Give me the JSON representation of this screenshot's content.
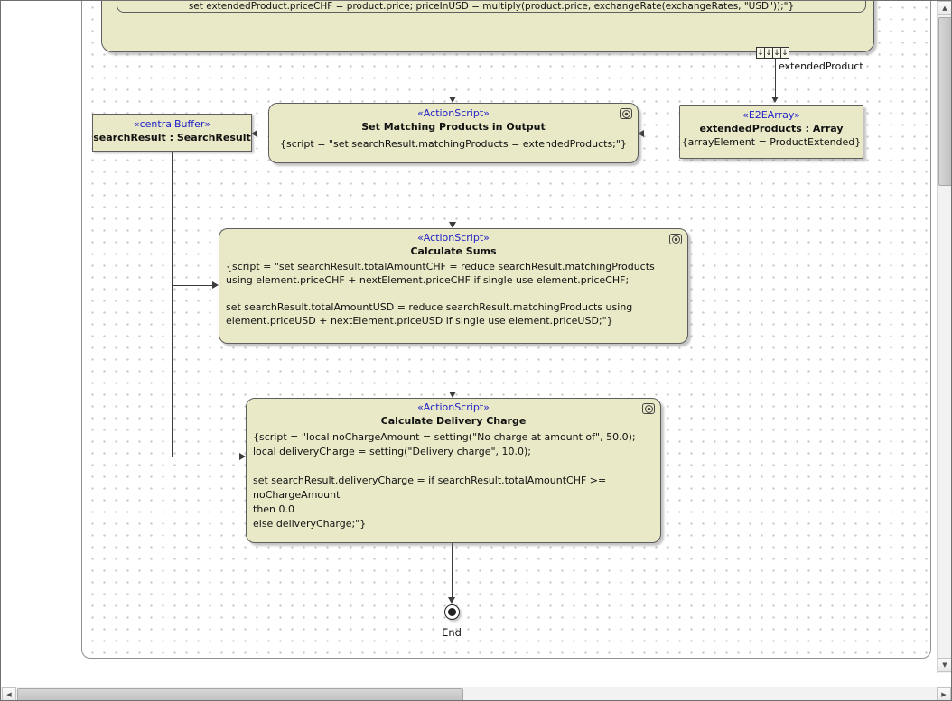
{
  "window": {
    "scrollbar_icons": {
      "up": "▲",
      "down": "▼",
      "left": "◀",
      "right": "▶"
    }
  },
  "diagram": {
    "colors": {
      "node_fill": "#e9e9c8",
      "node_border": "#5e5e5e",
      "stereotype_text": "#2121c8",
      "edge": "#3c3c3c",
      "grid_dot": "#c9c9c9"
    },
    "clipped_top_region": {
      "partial_script_text": "set extendedProduct.priceCHF = product.price; priceInUSD = multiply(product.price, exchangeRate(exchangeRates, \"USD\"));\"}"
    },
    "expansion_node": {
      "pin_glyph": "↓",
      "label": "extendedProduct"
    },
    "nodes": {
      "central_buffer": {
        "stereotype": "«centralBuffer»",
        "name": "searchResult : SearchResult"
      },
      "e2e_array": {
        "stereotype": "«E2EArray»",
        "name": "extendedProducts : Array",
        "tagged_value": "{arrayElement = ProductExtended}"
      },
      "set_matching_products": {
        "stereotype": "«ActionScript»",
        "title": "Set Matching Products in Output",
        "script": "{script = \"set searchResult.matchingProducts = extendedProducts;\"}"
      },
      "calculate_sums": {
        "stereotype": "«ActionScript»",
        "title": "Calculate Sums",
        "script_lines": [
          "{script = \"set searchResult.totalAmountCHF = reduce searchResult.matchingProducts",
          "using element.priceCHF + nextElement.priceCHF if single use element.priceCHF;",
          "",
          "set searchResult.totalAmountUSD = reduce searchResult.matchingProducts using",
          "element.priceUSD + nextElement.priceUSD if single use element.priceUSD;\"}"
        ]
      },
      "calculate_delivery_charge": {
        "stereotype": "«ActionScript»",
        "title": "Calculate Delivery Charge",
        "script_lines": [
          "{script = \"local noChargeAmount = setting(\"No charge at amount of\", 50.0);",
          "local deliveryCharge = setting(\"Delivery charge\", 10.0);",
          "",
          "set searchResult.deliveryCharge = if searchResult.totalAmountCHF >=",
          "noChargeAmount",
          "then 0.0",
          "else deliveryCharge;\"}"
        ]
      },
      "end_node": {
        "label": "End"
      }
    }
  }
}
